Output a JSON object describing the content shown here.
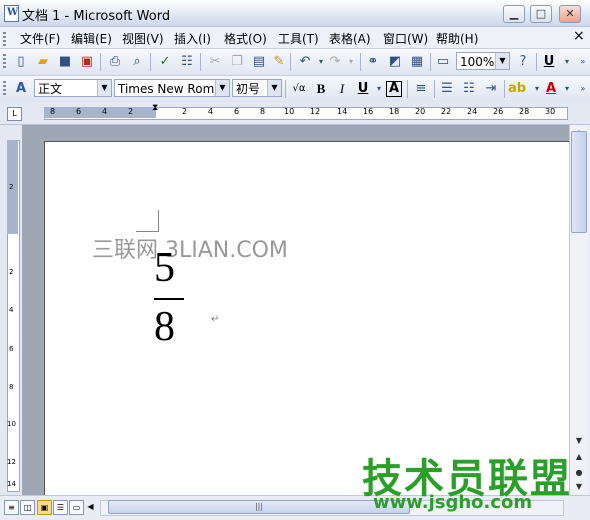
{
  "window": {
    "title": "文档 1 - Microsoft Word",
    "app_icon_letter": "W",
    "controls": [
      "▁",
      "□",
      "✕"
    ]
  },
  "menu": {
    "items": [
      "文件(F)",
      "编辑(E)",
      "视图(V)",
      "插入(I)",
      "格式(O)",
      "工具(T)",
      "表格(A)",
      "窗口(W)",
      "帮助(H)"
    ],
    "close_glyph": "×"
  },
  "standard_toolbar": {
    "zoom": "100%"
  },
  "format_toolbar": {
    "style": "正文",
    "font": "Times New Roma",
    "size": "初号",
    "bold": "B",
    "italic": "I",
    "underline": "U",
    "char_border": "A",
    "font_color": "A",
    "sqrt_symbol": "√α",
    "underline_std": "U"
  },
  "ruler": {
    "tab_selector": "L",
    "numbers": [
      "8",
      "6",
      "4",
      "2",
      "2",
      "4",
      "6",
      "8",
      "10",
      "12",
      "14",
      "16",
      "18",
      "20",
      "22",
      "24",
      "26",
      "28",
      "30"
    ],
    "vertical_numbers": [
      "2",
      "2",
      "4",
      "6",
      "8",
      "10",
      "12",
      "14"
    ]
  },
  "document": {
    "watermark": "三联网 3LIAN.COM",
    "numerator": "5",
    "denominator": "8",
    "paragraph_mark": "↵"
  },
  "branding": {
    "cn_name": "技术员联盟",
    "url": "www.jsgho.com"
  },
  "colors": {
    "brand_green": "#2aa02a",
    "page_bg": "#ffffff",
    "work_area": "#9fa6b4"
  }
}
